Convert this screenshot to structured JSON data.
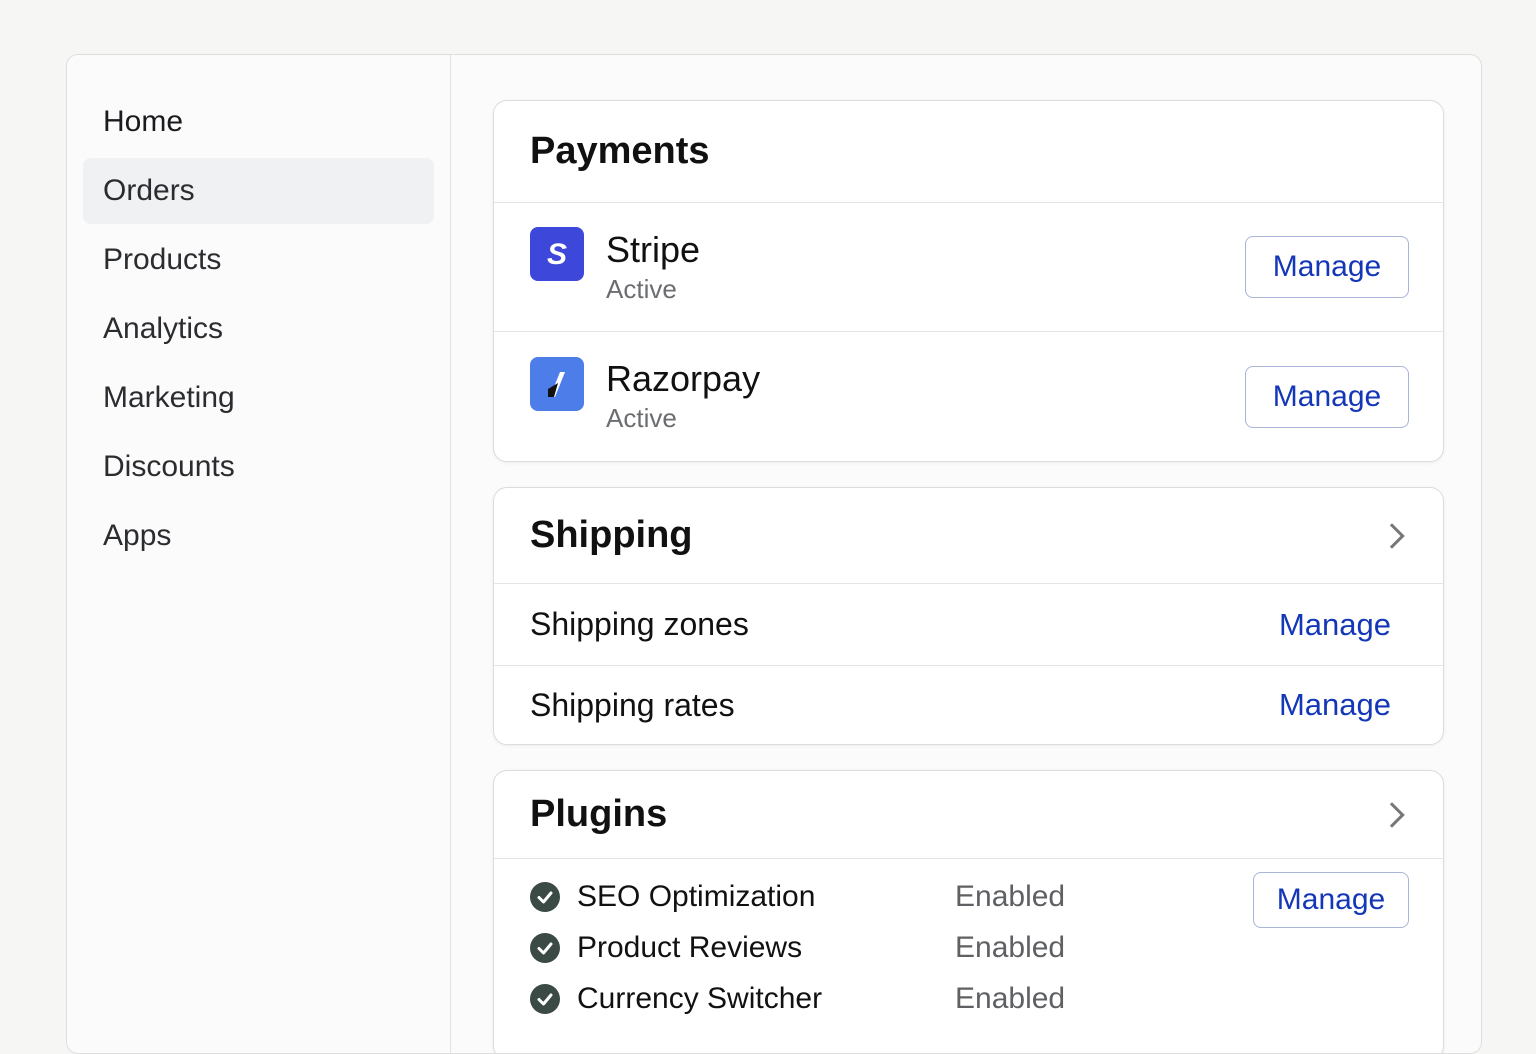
{
  "sidebar": {
    "items": [
      {
        "label": "Home",
        "active": false
      },
      {
        "label": "Orders",
        "active": true
      },
      {
        "label": "Products",
        "active": false
      },
      {
        "label": "Analytics",
        "active": false
      },
      {
        "label": "Marketing",
        "active": false
      },
      {
        "label": "Discounts",
        "active": false
      },
      {
        "label": "Apps",
        "active": false
      }
    ]
  },
  "payments": {
    "title": "Payments",
    "providers": [
      {
        "name": "Stripe",
        "status": "Active",
        "action": "Manage",
        "logo": "stripe-logo",
        "logo_color": "#3d47d9"
      },
      {
        "name": "Razorpay",
        "status": "Active",
        "action": "Manage",
        "logo": "razorpay-logo",
        "logo_color": "#4d7de9"
      }
    ]
  },
  "shipping": {
    "title": "Shipping",
    "rows": [
      {
        "label": "Shipping zones",
        "action": "Manage"
      },
      {
        "label": "Shipping rates",
        "action": "Manage"
      }
    ]
  },
  "plugins": {
    "title": "Plugins",
    "action": "Manage",
    "items": [
      {
        "name": "SEO Optimization",
        "status": "Enabled"
      },
      {
        "name": "Product Reviews",
        "status": "Enabled"
      },
      {
        "name": "Currency Switcher",
        "status": "Enabled"
      }
    ]
  },
  "colors": {
    "link": "#1437b8",
    "active_nav_bg": "#f0f1f2",
    "check": "#3b4a45"
  }
}
